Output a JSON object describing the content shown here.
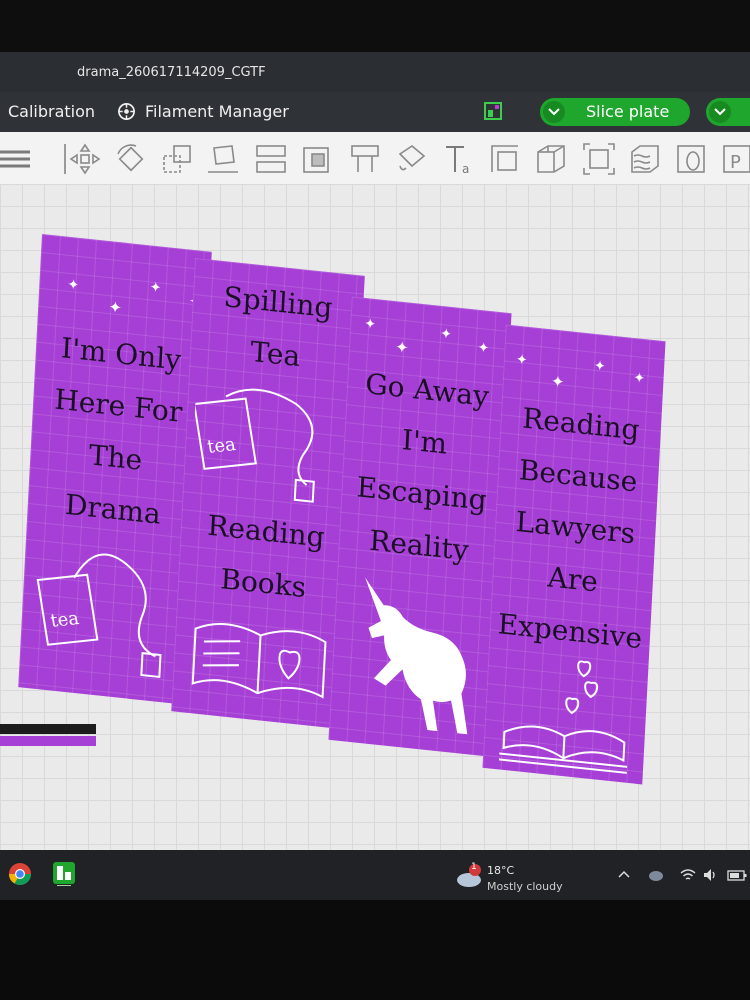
{
  "window": {
    "title": "drama_260617114209_CGTF"
  },
  "menubar": {
    "calibration": "Calibration",
    "filament_manager": "Filament Manager",
    "slice_plate": "Slice plate"
  },
  "toolbar": {
    "tools": [
      "menu-icon",
      "move-icon",
      "rotate-icon",
      "scale-icon",
      "place-on-face-icon",
      "split-icon",
      "cut-icon",
      "support-icon",
      "seam-icon",
      "paint-icon",
      "text-icon",
      "measure-icon",
      "assembly-icon",
      "fit-icon",
      "variable-layer-icon",
      "layer-icon",
      "preview-icon"
    ]
  },
  "bookmarks": [
    {
      "lines": [
        "I'm Only",
        "Here For",
        "The",
        "Drama"
      ],
      "image": "tea-bag-icon"
    },
    {
      "lines": [
        "Spilling",
        "Tea",
        "Reading",
        "Books"
      ],
      "image": "open-book-heart-icon"
    },
    {
      "lines": [
        "Go Away",
        "I'm",
        "Escaping",
        "Reality"
      ],
      "image": "unicorn-icon"
    },
    {
      "lines": [
        "Reading",
        "Because",
        "Lawyers",
        "Are",
        "Expensive"
      ],
      "image": "books-hearts-icon"
    }
  ],
  "colors": {
    "bookmark": "#a63fd6",
    "slice_button": "#1fa62d"
  },
  "taskbar": {
    "weather_temp": "18°C",
    "weather_condition": "Mostly cloudy",
    "notification_count": "1"
  }
}
